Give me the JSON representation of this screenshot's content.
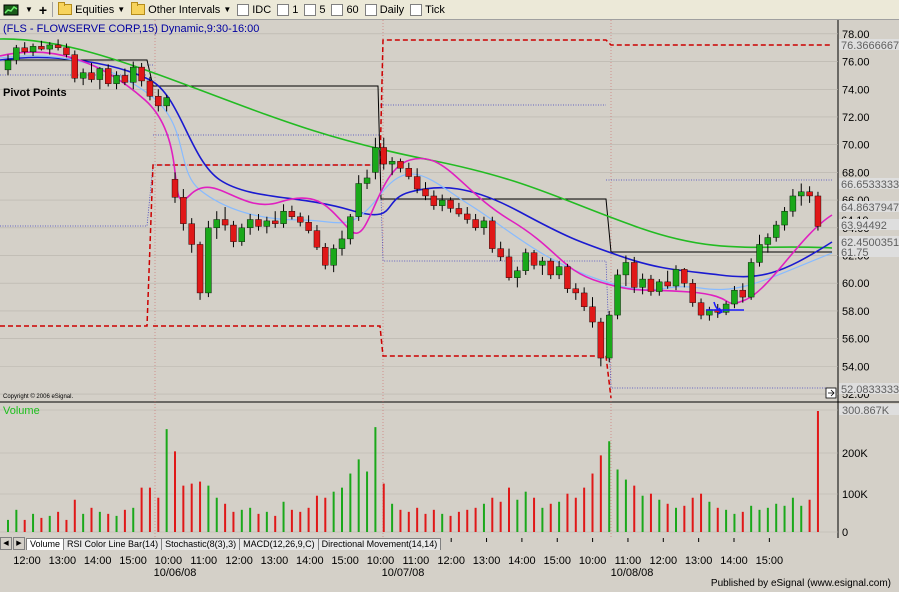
{
  "toolbar": {
    "equities_label": "Equities",
    "intervals_label": "Other Intervals",
    "intervals": [
      "IDC",
      "1",
      "5",
      "60",
      "Daily",
      "Tick"
    ]
  },
  "chart": {
    "title": "(FLS - FLOWSERVE CORP,15) Dynamic,9:30-16:00",
    "study_label": "Pivot Points",
    "copyright": "Copyright © 2006 eSignal.",
    "volume_label": "Volume",
    "price_ticks": [
      "78.00",
      "76.00",
      "74.00",
      "72.00",
      "70.00",
      "68.00",
      "66.00",
      "64.00",
      "62.00",
      "60.00",
      "58.00",
      "56.00",
      "54.00",
      "52.00"
    ],
    "price_tags": [
      {
        "text": "76.3666667",
        "color": "#cc0000"
      },
      {
        "text": "66.6533333",
        "color": "#000080"
      },
      {
        "text": "64.8637947",
        "color": "#000080"
      },
      {
        "text": "64.10",
        "color": "#ffffff"
      },
      {
        "text": "63.94492",
        "color": "#000080"
      },
      {
        "text": "62.4500351",
        "color": "#000080"
      },
      {
        "text": "61.75",
        "color": "#000080"
      },
      {
        "text": "52.0833333",
        "color": "#000080"
      }
    ],
    "volume_ticks": [
      "300.867K",
      "200K",
      "100K",
      "0"
    ],
    "time_labels": [
      "12:00",
      "13:00",
      "14:00",
      "15:00",
      "10:00",
      "11:00",
      "12:00",
      "13:00",
      "14:00",
      "15:00",
      "10:00",
      "11:00",
      "12:00",
      "13:00",
      "14:00",
      "15:00",
      "10:00",
      "11:00",
      "12:00",
      "13:00",
      "14:00",
      "15:00"
    ],
    "date_labels": [
      "10/06/08",
      "10/07/08",
      "10/08/08"
    ]
  },
  "tabs": [
    "Volume",
    "RSI Color Line Bar(14)",
    "Stochastic(8(3),3)",
    "MACD(12,26,9,C)",
    "Directional Movement(14,14)"
  ],
  "footer": "Published by eSignal (www.esignal.com)",
  "chart_data": {
    "type": "candlestick",
    "title": "(FLS - FLOWSERVE CORP,15) Dynamic,9:30-16:00",
    "ylim": [
      51.5,
      79
    ],
    "volume_ylim": [
      0,
      310
    ],
    "bars": [
      {
        "o": 75.4,
        "h": 76.5,
        "l": 75.0,
        "c": 76.1,
        "v": 30
      },
      {
        "o": 76.1,
        "h": 77.2,
        "l": 75.8,
        "c": 77.0,
        "v": 55
      },
      {
        "o": 77.0,
        "h": 77.4,
        "l": 76.5,
        "c": 76.7,
        "v": 30
      },
      {
        "o": 76.7,
        "h": 77.3,
        "l": 76.4,
        "c": 77.1,
        "v": 45
      },
      {
        "o": 77.1,
        "h": 77.5,
        "l": 76.8,
        "c": 76.9,
        "v": 35
      },
      {
        "o": 76.9,
        "h": 77.4,
        "l": 76.5,
        "c": 77.2,
        "v": 40
      },
      {
        "o": 77.2,
        "h": 77.6,
        "l": 76.8,
        "c": 77.0,
        "v": 50
      },
      {
        "o": 77.0,
        "h": 77.3,
        "l": 76.3,
        "c": 76.5,
        "v": 30
      },
      {
        "o": 76.5,
        "h": 76.8,
        "l": 74.5,
        "c": 74.8,
        "v": 80
      },
      {
        "o": 74.8,
        "h": 75.5,
        "l": 74.3,
        "c": 75.2,
        "v": 45
      },
      {
        "o": 75.2,
        "h": 75.9,
        "l": 74.5,
        "c": 74.7,
        "v": 60
      },
      {
        "o": 74.7,
        "h": 75.6,
        "l": 74.0,
        "c": 75.5,
        "v": 50
      },
      {
        "o": 75.5,
        "h": 75.8,
        "l": 74.2,
        "c": 74.4,
        "v": 45
      },
      {
        "o": 74.4,
        "h": 75.3,
        "l": 74.0,
        "c": 75.0,
        "v": 40
      },
      {
        "o": 75.0,
        "h": 75.5,
        "l": 74.3,
        "c": 74.5,
        "v": 55
      },
      {
        "o": 74.5,
        "h": 76.0,
        "l": 74.0,
        "c": 75.6,
        "v": 60
      },
      {
        "o": 75.6,
        "h": 75.9,
        "l": 74.2,
        "c": 74.6,
        "v": 110
      },
      {
        "o": 74.6,
        "h": 74.9,
        "l": 73.2,
        "c": 73.5,
        "v": 110
      },
      {
        "o": 73.5,
        "h": 74.0,
        "l": 72.4,
        "c": 72.8,
        "v": 85
      },
      {
        "o": 72.8,
        "h": 73.6,
        "l": 72.4,
        "c": 73.4,
        "v": 255
      },
      {
        "o": 67.5,
        "h": 68.0,
        "l": 65.8,
        "c": 66.2,
        "v": 200
      },
      {
        "o": 66.2,
        "h": 66.8,
        "l": 63.8,
        "c": 64.3,
        "v": 115
      },
      {
        "o": 64.3,
        "h": 64.7,
        "l": 62.2,
        "c": 62.8,
        "v": 120
      },
      {
        "o": 62.8,
        "h": 63.0,
        "l": 58.8,
        "c": 59.3,
        "v": 125
      },
      {
        "o": 59.3,
        "h": 64.5,
        "l": 59.0,
        "c": 64.0,
        "v": 115
      },
      {
        "o": 64.0,
        "h": 65.2,
        "l": 63.2,
        "c": 64.6,
        "v": 85
      },
      {
        "o": 64.6,
        "h": 65.5,
        "l": 63.8,
        "c": 64.2,
        "v": 70
      },
      {
        "o": 64.2,
        "h": 64.5,
        "l": 62.6,
        "c": 63.0,
        "v": 50
      },
      {
        "o": 63.0,
        "h": 64.3,
        "l": 62.7,
        "c": 64.0,
        "v": 55
      },
      {
        "o": 64.0,
        "h": 65.0,
        "l": 63.5,
        "c": 64.6,
        "v": 60
      },
      {
        "o": 64.6,
        "h": 65.0,
        "l": 63.8,
        "c": 64.1,
        "v": 45
      },
      {
        "o": 64.1,
        "h": 64.8,
        "l": 63.6,
        "c": 64.5,
        "v": 50
      },
      {
        "o": 64.5,
        "h": 65.2,
        "l": 64.0,
        "c": 64.3,
        "v": 40
      },
      {
        "o": 64.3,
        "h": 65.7,
        "l": 64.0,
        "c": 65.2,
        "v": 75
      },
      {
        "o": 65.2,
        "h": 65.6,
        "l": 64.6,
        "c": 64.8,
        "v": 55
      },
      {
        "o": 64.8,
        "h": 65.1,
        "l": 64.1,
        "c": 64.4,
        "v": 50
      },
      {
        "o": 64.4,
        "h": 64.9,
        "l": 63.6,
        "c": 63.8,
        "v": 60
      },
      {
        "o": 63.8,
        "h": 64.2,
        "l": 62.4,
        "c": 62.6,
        "v": 90
      },
      {
        "o": 62.6,
        "h": 62.9,
        "l": 61.0,
        "c": 61.3,
        "v": 85
      },
      {
        "o": 61.3,
        "h": 62.8,
        "l": 60.8,
        "c": 62.5,
        "v": 100
      },
      {
        "o": 62.5,
        "h": 63.8,
        "l": 62.0,
        "c": 63.2,
        "v": 110
      },
      {
        "o": 63.2,
        "h": 65.0,
        "l": 62.8,
        "c": 64.8,
        "v": 145
      },
      {
        "o": 64.8,
        "h": 67.8,
        "l": 64.5,
        "c": 67.2,
        "v": 180
      },
      {
        "o": 67.2,
        "h": 68.2,
        "l": 66.8,
        "c": 67.6,
        "v": 150
      },
      {
        "o": 68.0,
        "h": 70.5,
        "l": 67.5,
        "c": 69.8,
        "v": 260
      },
      {
        "o": 69.8,
        "h": 70.5,
        "l": 68.2,
        "c": 68.6,
        "v": 120
      },
      {
        "o": 68.6,
        "h": 69.1,
        "l": 67.8,
        "c": 68.8,
        "v": 70
      },
      {
        "o": 68.8,
        "h": 69.0,
        "l": 68.0,
        "c": 68.3,
        "v": 55
      },
      {
        "o": 68.3,
        "h": 68.7,
        "l": 67.5,
        "c": 67.7,
        "v": 50
      },
      {
        "o": 67.7,
        "h": 68.3,
        "l": 66.5,
        "c": 66.8,
        "v": 60
      },
      {
        "o": 66.8,
        "h": 67.3,
        "l": 66.0,
        "c": 66.3,
        "v": 45
      },
      {
        "o": 66.3,
        "h": 66.7,
        "l": 65.3,
        "c": 65.6,
        "v": 55
      },
      {
        "o": 65.6,
        "h": 66.4,
        "l": 65.2,
        "c": 66.0,
        "v": 45
      },
      {
        "o": 66.0,
        "h": 66.2,
        "l": 65.1,
        "c": 65.4,
        "v": 40
      },
      {
        "o": 65.4,
        "h": 65.8,
        "l": 64.8,
        "c": 65.0,
        "v": 50
      },
      {
        "o": 65.0,
        "h": 65.5,
        "l": 64.3,
        "c": 64.6,
        "v": 55
      },
      {
        "o": 64.6,
        "h": 65.0,
        "l": 63.8,
        "c": 64.0,
        "v": 60
      },
      {
        "o": 64.0,
        "h": 64.8,
        "l": 63.5,
        "c": 64.5,
        "v": 70
      },
      {
        "o": 64.5,
        "h": 64.8,
        "l": 62.2,
        "c": 62.5,
        "v": 85
      },
      {
        "o": 62.5,
        "h": 63.0,
        "l": 61.6,
        "c": 61.9,
        "v": 75
      },
      {
        "o": 61.9,
        "h": 62.5,
        "l": 60.2,
        "c": 60.4,
        "v": 110
      },
      {
        "o": 60.4,
        "h": 61.2,
        "l": 59.7,
        "c": 60.9,
        "v": 80
      },
      {
        "o": 60.9,
        "h": 62.5,
        "l": 60.6,
        "c": 62.2,
        "v": 100
      },
      {
        "o": 62.2,
        "h": 62.4,
        "l": 61.0,
        "c": 61.3,
        "v": 85
      },
      {
        "o": 61.3,
        "h": 61.9,
        "l": 60.6,
        "c": 61.6,
        "v": 60
      },
      {
        "o": 61.6,
        "h": 61.8,
        "l": 60.3,
        "c": 60.6,
        "v": 70
      },
      {
        "o": 60.6,
        "h": 61.6,
        "l": 60.3,
        "c": 61.2,
        "v": 75
      },
      {
        "o": 61.2,
        "h": 61.4,
        "l": 59.3,
        "c": 59.6,
        "v": 95
      },
      {
        "o": 59.6,
        "h": 60.0,
        "l": 58.8,
        "c": 59.3,
        "v": 85
      },
      {
        "o": 59.3,
        "h": 59.7,
        "l": 58.0,
        "c": 58.3,
        "v": 110
      },
      {
        "o": 58.3,
        "h": 59.0,
        "l": 56.8,
        "c": 57.2,
        "v": 145
      },
      {
        "o": 57.2,
        "h": 57.5,
        "l": 54.0,
        "c": 54.6,
        "v": 190
      },
      {
        "o": 54.6,
        "h": 58.0,
        "l": 54.3,
        "c": 57.7,
        "v": 225
      },
      {
        "o": 57.7,
        "h": 61.0,
        "l": 57.4,
        "c": 60.6,
        "v": 155
      },
      {
        "o": 60.6,
        "h": 62.0,
        "l": 59.8,
        "c": 61.5,
        "v": 130
      },
      {
        "o": 61.5,
        "h": 61.9,
        "l": 59.3,
        "c": 59.7,
        "v": 115
      },
      {
        "o": 59.7,
        "h": 60.7,
        "l": 59.2,
        "c": 60.3,
        "v": 90
      },
      {
        "o": 60.3,
        "h": 60.6,
        "l": 59.1,
        "c": 59.4,
        "v": 95
      },
      {
        "o": 59.4,
        "h": 60.3,
        "l": 59.1,
        "c": 60.1,
        "v": 80
      },
      {
        "o": 60.1,
        "h": 60.9,
        "l": 59.6,
        "c": 59.8,
        "v": 70
      },
      {
        "o": 59.8,
        "h": 61.3,
        "l": 59.5,
        "c": 61.0,
        "v": 60
      },
      {
        "o": 61.0,
        "h": 61.1,
        "l": 59.7,
        "c": 60.0,
        "v": 65
      },
      {
        "o": 60.0,
        "h": 60.3,
        "l": 58.3,
        "c": 58.6,
        "v": 85
      },
      {
        "o": 58.6,
        "h": 58.9,
        "l": 57.4,
        "c": 57.7,
        "v": 95
      },
      {
        "o": 57.7,
        "h": 58.3,
        "l": 57.3,
        "c": 58.1,
        "v": 75
      },
      {
        "o": 58.1,
        "h": 58.5,
        "l": 57.5,
        "c": 57.9,
        "v": 60
      },
      {
        "o": 57.9,
        "h": 58.7,
        "l": 57.7,
        "c": 58.5,
        "v": 55
      },
      {
        "o": 58.5,
        "h": 59.8,
        "l": 58.2,
        "c": 59.5,
        "v": 45
      },
      {
        "o": 59.5,
        "h": 60.0,
        "l": 58.6,
        "c": 59.0,
        "v": 50
      },
      {
        "o": 59.0,
        "h": 61.8,
        "l": 58.8,
        "c": 61.5,
        "v": 65
      },
      {
        "o": 61.5,
        "h": 63.5,
        "l": 61.2,
        "c": 62.8,
        "v": 55
      },
      {
        "o": 62.8,
        "h": 63.6,
        "l": 62.2,
        "c": 63.3,
        "v": 60
      },
      {
        "o": 63.3,
        "h": 64.5,
        "l": 63.0,
        "c": 64.2,
        "v": 70
      },
      {
        "o": 64.2,
        "h": 65.5,
        "l": 63.8,
        "c": 65.2,
        "v": 65
      },
      {
        "o": 65.2,
        "h": 66.8,
        "l": 64.8,
        "c": 66.3,
        "v": 85
      },
      {
        "o": 66.3,
        "h": 67.2,
        "l": 65.6,
        "c": 66.6,
        "v": 65
      },
      {
        "o": 66.6,
        "h": 67.0,
        "l": 65.8,
        "c": 66.3,
        "v": 80
      },
      {
        "o": 66.3,
        "h": 66.6,
        "l": 63.8,
        "c": 64.1,
        "v": 300
      }
    ]
  }
}
